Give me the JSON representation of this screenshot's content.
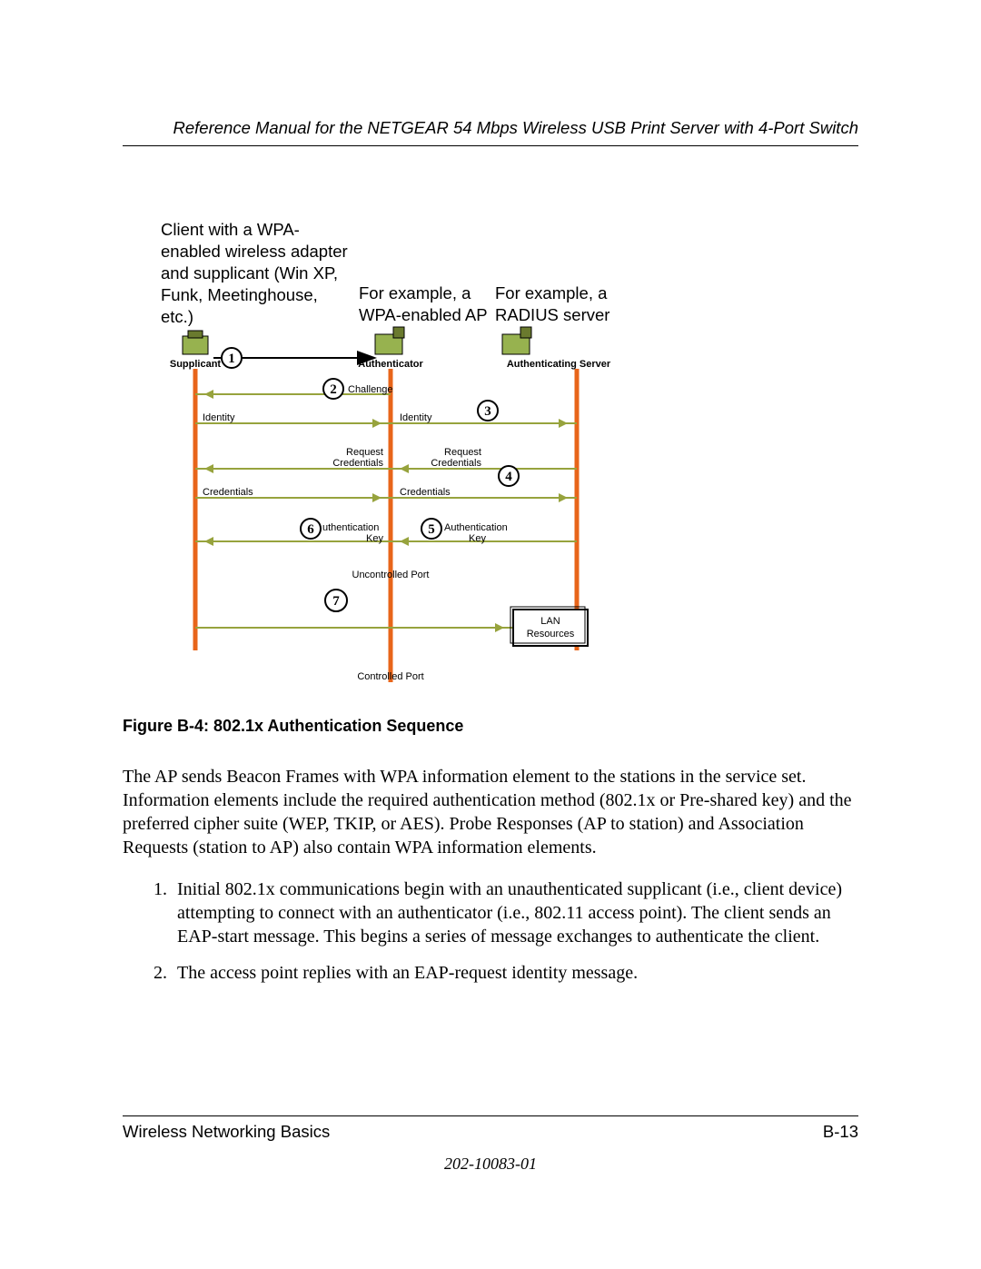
{
  "header": {
    "title": "Reference Manual for the NETGEAR 54 Mbps Wireless USB Print Server with 4-Port Switch"
  },
  "labels": {
    "client": "Client with a WPA-enabled wireless adapter and supplicant (Win XP, Funk, Meetinghouse, etc.)",
    "ap": "For example, a WPA-enabled AP",
    "server": "For example, a RADIUS server"
  },
  "diagram": {
    "supplicant": "Supplicant",
    "authenticator": "Authenticator",
    "authserver": "Authenticating Server",
    "challenge": "Challenge",
    "identity": "Identity",
    "request_cred": "Request",
    "credentials_word": "Credentials",
    "credentials": "Credentials",
    "uthkey": "uthentication",
    "authkey": "Authentication",
    "key": "Key",
    "uncontrolled": "Uncontrolled Port",
    "controlled": "Controlled Port",
    "lan": "LAN",
    "resources": "Resources",
    "n1": "1",
    "n2": "2",
    "n3": "3",
    "n4": "4",
    "n5": "5",
    "n6": "6",
    "n7": "7"
  },
  "figure_caption": "Figure B-4:  802.1x Authentication Sequence",
  "body_para": "The AP sends Beacon Frames with WPA information element to the stations in the service set. Information elements include the required authentication method (802.1x or Pre-shared key) and the preferred cipher suite (WEP, TKIP, or AES). Probe Responses (AP to station) and Association Requests (station to AP) also contain WPA information elements.",
  "steps": {
    "s1": "Initial 802.1x communications begin with an unauthenticated supplicant (i.e., client device) attempting to connect with an authenticator (i.e., 802.11 access point). The client sends an EAP-start message. This begins a series of message exchanges to authenticate the client.",
    "s2": "The access point replies with an EAP-request identity message."
  },
  "footer": {
    "section": "Wireless Networking Basics",
    "page": "B-13",
    "docnum": "202-10083-01"
  }
}
